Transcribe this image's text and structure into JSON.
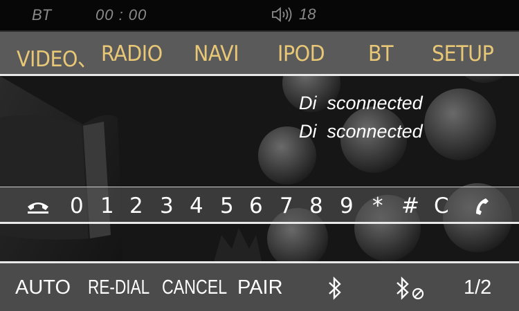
{
  "status_bar": {
    "mode": "BT",
    "time": "00 : 00",
    "volume_icon": "speaker-icon",
    "volume_level": "18"
  },
  "nav": {
    "items": [
      "VIDEO、",
      "RADIO",
      "NAVI",
      "IPOD",
      "BT",
      "SETUP"
    ]
  },
  "connection": {
    "lines": [
      "Di  sconnected",
      "Di  sconnected"
    ]
  },
  "dial_pad": {
    "hangup_icon": "hang-up-icon",
    "keys": [
      "0",
      "1",
      "2",
      "3",
      "4",
      "5",
      "6",
      "7",
      "8",
      "9",
      "*",
      "#",
      "C"
    ],
    "call_icon": "call-icon"
  },
  "bottom_bar": {
    "auto": "AUTO",
    "redial": "RE-DIAL",
    "cancel": "CANCEL",
    "pair": "PAIR",
    "bluetooth_icon": "bluetooth-icon",
    "bluetooth_off_icon": "bluetooth-disconnect-icon",
    "page": "1/2"
  },
  "colors": {
    "nav_text": "#e8c777",
    "bar_gray": "#5a5a5a",
    "text": "#ffffff"
  }
}
